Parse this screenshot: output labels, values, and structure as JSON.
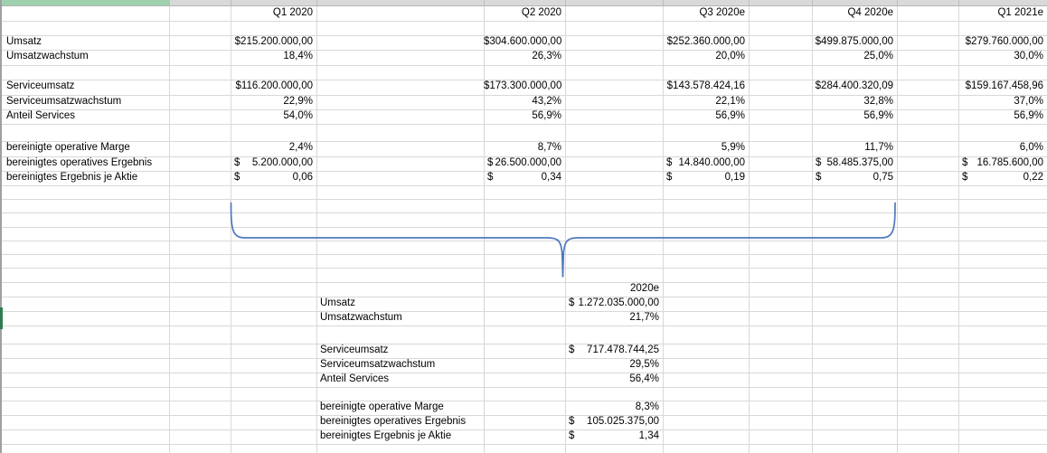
{
  "app": {
    "type": "spreadsheet-worksheet"
  },
  "colors": {
    "gridline": "#d8d8d8",
    "column_header_strip": "#d9d9d9",
    "selected_column_header_green": "#9ed1ad",
    "active_row_marker_green": "#2f7d4f",
    "brace_blue": "#4e79bd"
  },
  "quarterly_table": {
    "column_headers": [
      "Q1 2020",
      "Q2 2020",
      "Q3 2020e",
      "Q4 2020e",
      "Q1 2021e"
    ],
    "groups": [
      {
        "rows": [
          {
            "label": "Umsatz",
            "values": [
              "$215.200.000,00",
              "$304.600.000,00",
              "$252.360.000,00",
              "$499.875.000,00",
              "$279.760.000,00"
            ]
          },
          {
            "label": "Umsatzwachstum",
            "values": [
              "18,4%",
              "26,3%",
              "20,0%",
              "25,0%",
              "30,0%"
            ]
          }
        ]
      },
      {
        "rows": [
          {
            "label": "Serviceumsatz",
            "values": [
              "$116.200.000,00",
              "$173.300.000,00",
              "$143.578.424,16",
              "$284.400.320,09",
              "$159.167.458,96"
            ]
          },
          {
            "label": "Serviceumsatzwachstum",
            "values": [
              "22,9%",
              "43,2%",
              "22,1%",
              "32,8%",
              "37,0%"
            ]
          },
          {
            "label": "Anteil Services",
            "values": [
              "54,0%",
              "56,9%",
              "56,9%",
              "56,9%",
              "56,9%"
            ]
          }
        ]
      },
      {
        "rows": [
          {
            "label": "bereinigte operative Marge",
            "values": [
              "2,4%",
              "8,7%",
              "5,9%",
              "11,7%",
              "6,0%"
            ]
          },
          {
            "label": "bereinigtes operatives Ergebnis",
            "accounting": true,
            "currency": "$",
            "values": [
              "5.200.000,00",
              "26.500.000,00",
              "14.840.000,00",
              "58.485.375,00",
              "16.785.600,00"
            ]
          },
          {
            "label": "bereinigtes Ergebnis je Aktie",
            "accounting": true,
            "currency": "$",
            "values": [
              "0,06",
              "0,34",
              "0,19",
              "0,75",
              "0,22"
            ]
          }
        ]
      }
    ]
  },
  "annual_summary": {
    "column_header": "2020e",
    "groups": [
      {
        "rows": [
          {
            "label": "Umsatz",
            "accounting": true,
            "currency": "$",
            "value": "1.272.035.000,00"
          },
          {
            "label": "Umsatzwachstum",
            "value": "21,7%"
          }
        ]
      },
      {
        "rows": [
          {
            "label": "Serviceumsatz",
            "accounting": true,
            "currency": "$",
            "value": "717.478.744,25"
          },
          {
            "label": "Serviceumsatzwachstum",
            "value": "29,5%"
          },
          {
            "label": "Anteil Services",
            "value": "56,4%"
          }
        ]
      },
      {
        "rows": [
          {
            "label": "bereinigte operative Marge",
            "value": "8,3%"
          },
          {
            "label": "bereinigtes operatives Ergebnis",
            "accounting": true,
            "currency": "$",
            "value": "105.025.375,00"
          },
          {
            "label": "bereinigtes Ergebnis je Aktie",
            "accounting": true,
            "currency": "$",
            "value": "1,34"
          }
        ]
      }
    ]
  }
}
